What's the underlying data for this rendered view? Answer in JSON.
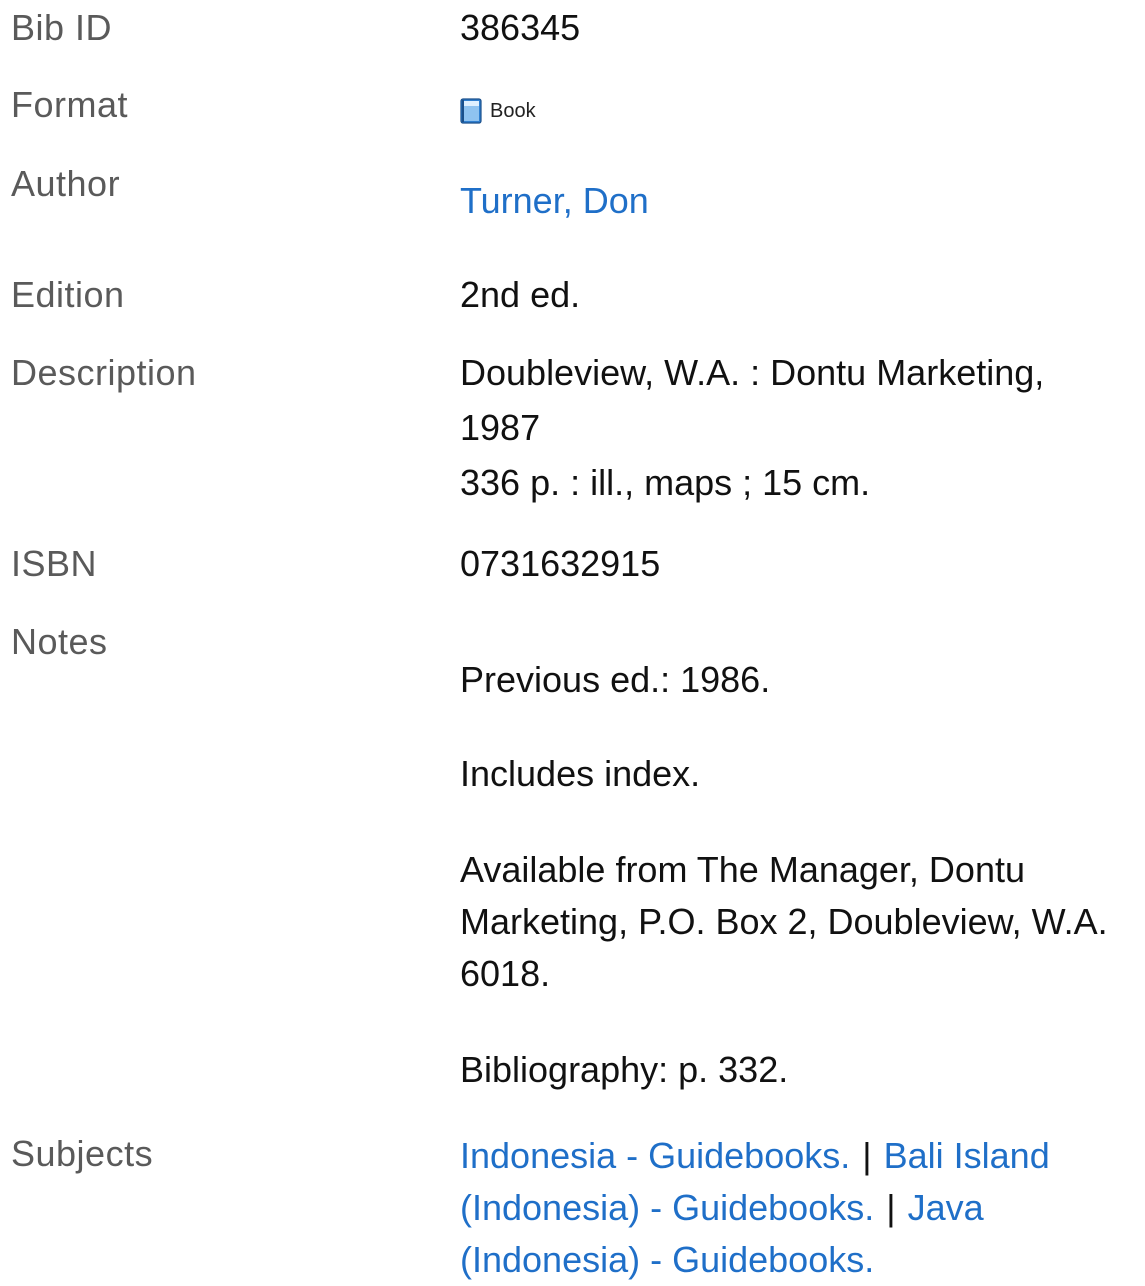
{
  "record": {
    "bib_id": {
      "label": "Bib ID",
      "value": "386345"
    },
    "format": {
      "label": "Format",
      "value": "Book",
      "icon": "book-icon"
    },
    "author": {
      "label": "Author",
      "value": "Turner, Don"
    },
    "edition": {
      "label": "Edition",
      "value": "2nd ed."
    },
    "description": {
      "label": "Description",
      "lines": [
        "Doubleview, W.A. : Dontu Marketing,",
        "1987",
        "336 p. : ill., maps ; 15 cm."
      ]
    },
    "isbn": {
      "label": "ISBN",
      "value": "0731632915"
    },
    "notes": {
      "label": "Notes",
      "items": [
        "Previous ed.: 1986.",
        "Includes index.",
        "Available from The Manager, Dontu Marketing, P.O. Box 2, Doubleview, W.A. 6018.",
        "Bibliography: p. 332."
      ]
    },
    "subjects": {
      "label": "Subjects",
      "separator": "|",
      "items": [
        "Indonesia - Guidebooks.",
        "Bali Island (Indonesia) - Guidebooks.",
        "Java (Indonesia) - Guidebooks."
      ]
    }
  },
  "colors": {
    "label": "#5a5a5a",
    "value": "#111111",
    "link": "#1f6fc8"
  }
}
